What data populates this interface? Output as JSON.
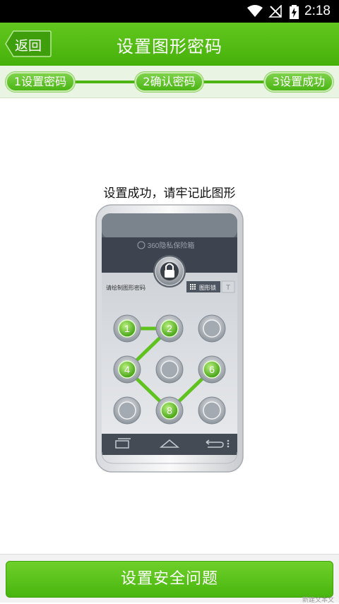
{
  "statusbar": {
    "time": "2:18",
    "icons": [
      "wifi-icon",
      "no-signal-icon",
      "battery-charging-icon"
    ]
  },
  "header": {
    "back_label": "返回",
    "title": "设置图形密码"
  },
  "steps": [
    {
      "label": "1设置密码"
    },
    {
      "label": "2确认密码"
    },
    {
      "label": "3设置成功"
    }
  ],
  "main": {
    "success_message": "设置成功，请牢记此图形",
    "phone_illustration": {
      "app_name": "360隐私保险箱",
      "prompt": "请绘制图形密码",
      "mode_label": "图形锁",
      "text_mode_label": "T",
      "dots": [
        "1",
        "2",
        "",
        "4",
        "",
        "6",
        "",
        "8",
        ""
      ],
      "pattern": [
        "1",
        "2",
        "4",
        "8",
        "6"
      ]
    }
  },
  "bottom": {
    "button_label": "设置安全问题"
  },
  "watermark": "新建文本文"
}
